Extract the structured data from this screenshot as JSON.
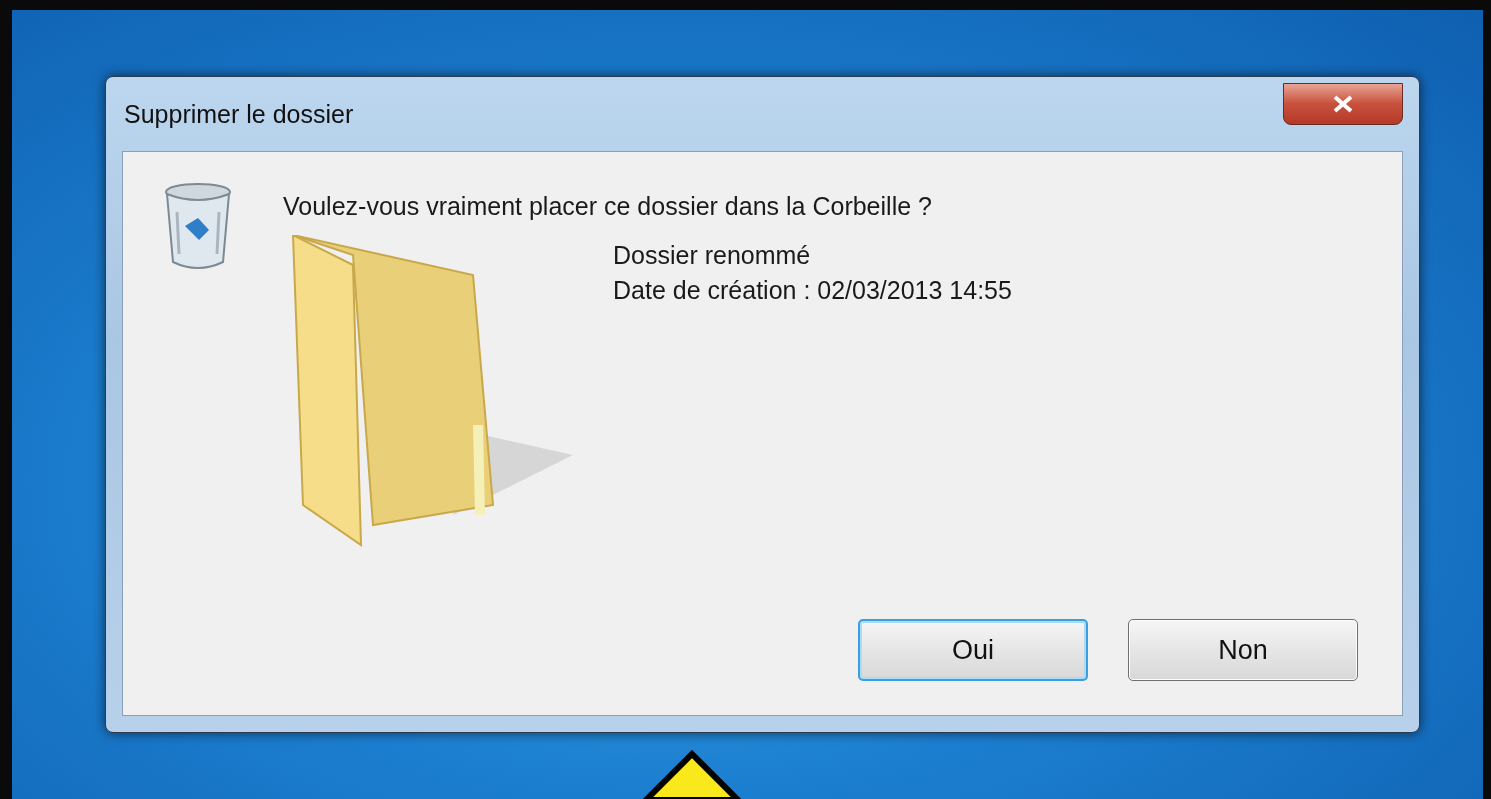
{
  "window": {
    "title": "Supprimer le dossier"
  },
  "message": "Voulez-vous vraiment placer ce dossier dans la Corbeille ?",
  "item": {
    "name": "Dossier renommé",
    "details": "Date de création : 02/03/2013 14:55"
  },
  "buttons": [
    {
      "label": "Oui",
      "selected": true
    },
    {
      "label": "Non",
      "selected": false
    }
  ]
}
